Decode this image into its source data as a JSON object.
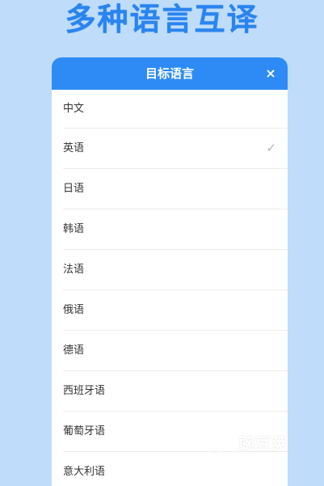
{
  "headline": "多种语言互译",
  "modal": {
    "title": "目标语言",
    "close_glyph": "×"
  },
  "languages": [
    {
      "label": "中文",
      "selected": false
    },
    {
      "label": "英语",
      "selected": true
    },
    {
      "label": "日语",
      "selected": false
    },
    {
      "label": "韩语",
      "selected": false
    },
    {
      "label": "法语",
      "selected": false
    },
    {
      "label": "俄语",
      "selected": false
    },
    {
      "label": "德语",
      "selected": false
    },
    {
      "label": "西班牙语",
      "selected": false
    },
    {
      "label": "葡萄牙语",
      "selected": false
    },
    {
      "label": "意大利语",
      "selected": false
    }
  ],
  "check_glyph": "✓",
  "watermark": {
    "text": "豌豆荚"
  },
  "colors": {
    "background": "#bfdcfb",
    "accent": "#2e8bf5",
    "headline": "#2a84ef"
  }
}
